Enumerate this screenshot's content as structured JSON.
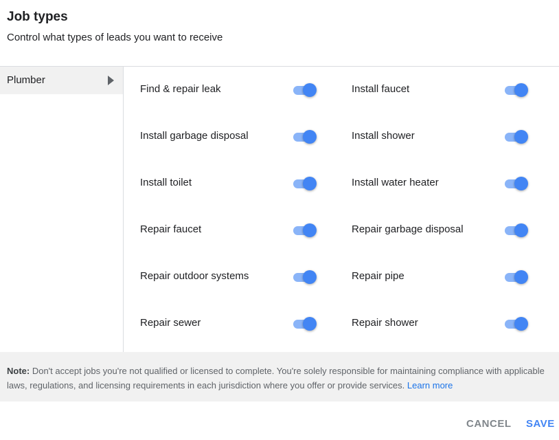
{
  "header": {
    "title": "Job types",
    "subtitle": "Control what types of leads you want to receive"
  },
  "sidebar": {
    "items": [
      {
        "label": "Plumber",
        "selected": true
      }
    ]
  },
  "job_types": [
    {
      "label": "Find & repair leak",
      "enabled": true
    },
    {
      "label": "Install faucet",
      "enabled": true
    },
    {
      "label": "Install garbage disposal",
      "enabled": true
    },
    {
      "label": "Install shower",
      "enabled": true
    },
    {
      "label": "Install toilet",
      "enabled": true
    },
    {
      "label": "Install water heater",
      "enabled": true
    },
    {
      "label": "Repair faucet",
      "enabled": true
    },
    {
      "label": "Repair garbage disposal",
      "enabled": true
    },
    {
      "label": "Repair outdoor systems",
      "enabled": true
    },
    {
      "label": "Repair pipe",
      "enabled": true
    },
    {
      "label": "Repair sewer",
      "enabled": true
    },
    {
      "label": "Repair shower",
      "enabled": true
    }
  ],
  "note": {
    "prefix": "Note:",
    "text": " Don't accept jobs you're not qualified or licensed to complete. You're solely responsible for maintaining compliance with applicable laws, regulations, and licensing requirements in each jurisdiction where you offer or provide services. ",
    "link": "Learn more"
  },
  "footer": {
    "cancel_label": "CANCEL",
    "save_label": "SAVE"
  },
  "colors": {
    "toggle_track_on": "#8ab4f8",
    "toggle_knob_on": "#4285f4",
    "link": "#1a73e8",
    "save": "#4285f4"
  }
}
